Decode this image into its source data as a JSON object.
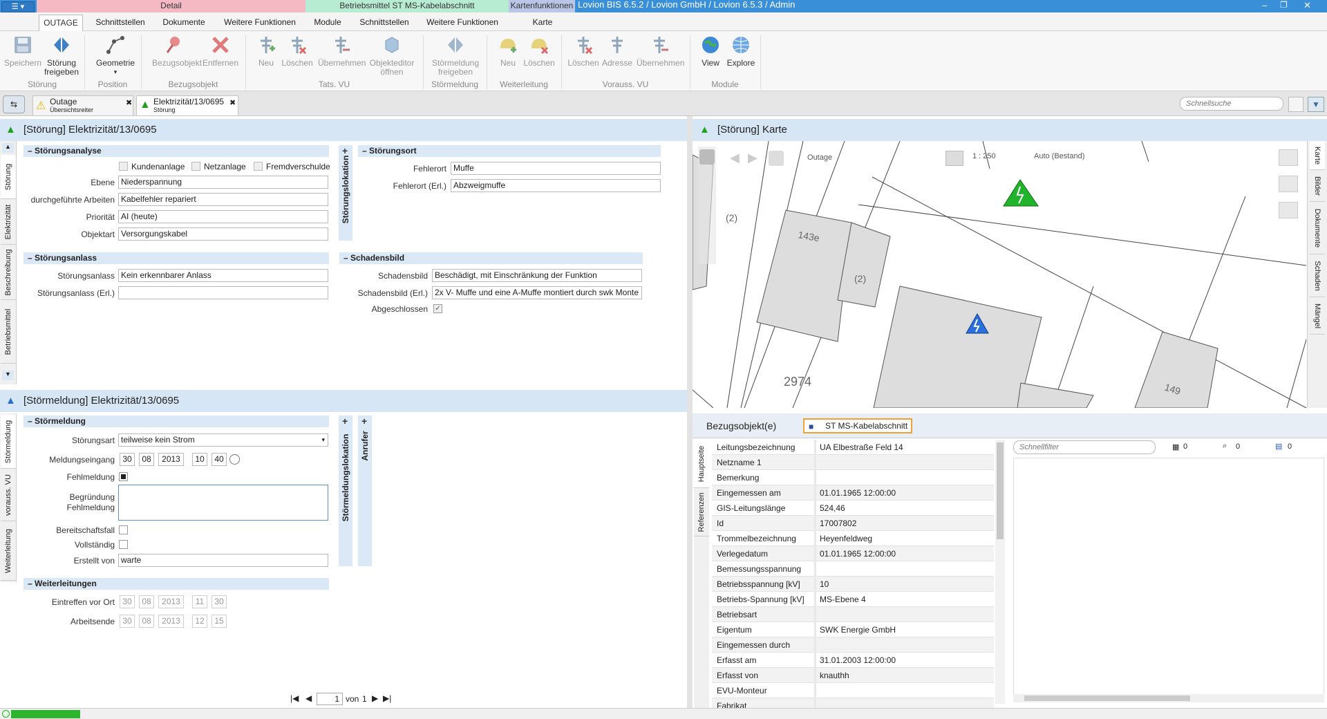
{
  "app": {
    "title": "Lovion BIS 6.5.2 / Lovion GmbH / Lovion 6.5.3 / Admin",
    "menu_button_icon": "app-menu-icon"
  },
  "context_tabs": {
    "detail": "Detail",
    "betriebsmittel": "Betriebsmittel ST MS-Kabelabschnitt",
    "kartenfunktionen": "Kartenfunktionen"
  },
  "ribbon_tabs": [
    "OUTAGE",
    "Schnittstellen",
    "Dokumente",
    "Weitere Funktionen",
    "Module",
    "Schnittstellen",
    "Weitere Funktionen",
    "Karte"
  ],
  "ribbon": {
    "groups": [
      "Störung",
      "Position",
      "Bezugsobjekt",
      "Tats. VU",
      "Störmeldung",
      "Weiterleitung",
      "Vorauss. VU",
      "Module"
    ],
    "buttons": {
      "speichern": "Speichern",
      "stoerung_freigeben": "Störung freigeben",
      "geometrie": "Geometrie",
      "bezugsobjekt": "Bezugsobjekt",
      "entfernen": "Entfernen",
      "neu": "Neu",
      "loeschen": "Löschen",
      "uebernehmen": "Übernehmen",
      "objekteditor": "Objekteditor öffnen",
      "stoermeldung_freigeben": "Störmeldung freigeben",
      "wl_neu": "Neu",
      "wl_loeschen": "Löschen",
      "vu_loeschen": "Löschen",
      "vu_adresse": "Adresse",
      "vu_uebernehmen": "Übernehmen",
      "view": "View",
      "explore": "Explore"
    }
  },
  "doc_tabs": [
    {
      "title": "Outage",
      "subtitle": "Übersichtsreiter"
    },
    {
      "title": "Elektrizität/13/0695",
      "subtitle": "Störung"
    }
  ],
  "search": {
    "placeholder": "Schnellsuche"
  },
  "stoerung_panel": {
    "title": "[Störung] Elektrizität/13/0695",
    "side_tabs": [
      "Störung",
      "Elektrizität",
      "Beschreibung",
      "Betriebsmittel"
    ],
    "analyse": {
      "header": "Störungsanalyse",
      "cb_kunden": "Kundenanlage",
      "cb_netz": "Netzanlage",
      "cb_fremd": "Fremdverschulde",
      "ebene_label": "Ebene",
      "ebene": "Niederspannung",
      "arbeiten_label": "durchgeführte Arbeiten",
      "arbeiten": "Kabelfehler repariert",
      "prio_label": "Priorität",
      "prio": "AI (heute)",
      "objektart_label": "Objektart",
      "objektart": "Versorgungskabel"
    },
    "lokation_tab": "Störungslokation",
    "ort": {
      "header": "Störungsort",
      "fehlerort_label": "Fehlerort",
      "fehlerort": "Muffe",
      "fehlerort_erl_label": "Fehlerort (Erl.)",
      "fehlerort_erl": "Abzweigmuffe"
    },
    "anlass": {
      "header": "Störungsanlass",
      "anlass_label": "Störungsanlass",
      "anlass": "Kein erkennbarer Anlass",
      "anlass_erl_label": "Störungsanlass (Erl.)",
      "anlass_erl": ""
    },
    "schaden": {
      "header": "Schadensbild",
      "bild_label": "Schadensbild",
      "bild": "Beschädigt, mit Einschränkung der Funktion",
      "bild_erl_label": "Schadensbild (Erl.)",
      "bild_erl": "2x V- Muffe und eine A-Muffe montiert durch swk Monte",
      "abgeschlossen_label": "Abgeschlossen",
      "abgeschlossen": true
    }
  },
  "meldung_panel": {
    "title": "[Störmeldung] Elektrizität/13/0695",
    "side_tabs": [
      "Störmeldung",
      "vorauss. VU",
      "Weiterleitung"
    ],
    "header": "Störmeldung",
    "art_label": "Störungsart",
    "art": "teilweise kein Strom",
    "eingang_label": "Meldungseingang",
    "eingang": {
      "d": "30",
      "m": "08",
      "y": "2013",
      "h": "10",
      "min": "40"
    },
    "fehl_label": "Fehlmeldung",
    "fehl": true,
    "begr_label": "Begründung Fehlmeldung",
    "begr": "",
    "bereit_label": "Bereitschaftsfall",
    "voll_label": "Vollständig",
    "erstellt_label": "Erstellt von",
    "erstellt": "warte",
    "lokation_tab": "Störmeldungslokation",
    "anrufer_tab": "Anrufer",
    "weiter_header": "Weiterleitungen",
    "eintreffen_label": "Eintreffen vor Ort",
    "eintreffen": {
      "d": "30",
      "m": "08",
      "y": "2013",
      "h": "11",
      "min": "30"
    },
    "ende_label": "Arbeitsende",
    "ende": {
      "d": "30",
      "m": "08",
      "y": "2013",
      "h": "12",
      "min": "15"
    },
    "pager": {
      "page": "1",
      "von": "von",
      "total": "1"
    }
  },
  "map_panel": {
    "title": "[Störung] Karte",
    "layer": "Outage",
    "scale": "1 : 250",
    "mode": "Auto (Bestand)",
    "labels": {
      "a": "(2)",
      "b": "143e",
      "c": "(2)",
      "d": "2974",
      "e": "149"
    },
    "side_tabs": [
      "Karte",
      "Bilder",
      "Dokumente",
      "Schaden",
      "Mängel"
    ]
  },
  "bezug": {
    "label": "Bezugsobjekt(e)",
    "object": "ST MS-Kabelabschnitt",
    "side_tabs": [
      "Hauptseite",
      "Referenzen"
    ],
    "filter_placeholder": "Schnellfilter",
    "count1": "0",
    "count2": "0",
    "count3": "0",
    "rows": [
      {
        "k": "Leitungsbezeichnung",
        "v": "UA Elbestraße Feld 14"
      },
      {
        "k": "Netzname 1",
        "v": ""
      },
      {
        "k": "Bemerkung",
        "v": ""
      },
      {
        "k": "Eingemessen am",
        "v": "01.01.1965 12:00:00"
      },
      {
        "k": "GIS-Leitungslänge",
        "v": "524,46"
      },
      {
        "k": "Id",
        "v": "17007802"
      },
      {
        "k": "Trommelbezeichnung",
        "v": "Heyenfeldweg"
      },
      {
        "k": "Verlegedatum",
        "v": "01.01.1965 12:00:00"
      },
      {
        "k": "Bemessungsspannung",
        "v": ""
      },
      {
        "k": "Betriebsspannung [kV]",
        "v": "10"
      },
      {
        "k": "Betriebs-Spannung [kV]",
        "v": "MS-Ebene 4"
      },
      {
        "k": "Betriebsart",
        "v": ""
      },
      {
        "k": "Eigentum",
        "v": "SWK Energie GmbH"
      },
      {
        "k": "Eingemessen durch",
        "v": ""
      },
      {
        "k": "Erfasst am",
        "v": "31.01.2003 12:00:00"
      },
      {
        "k": "Erfasst von",
        "v": "knauthh"
      },
      {
        "k": "EVU-Monteur",
        "v": ""
      },
      {
        "k": "Fabrikat",
        "v": ""
      }
    ]
  },
  "colors": {
    "accent": "#3a8fd9",
    "panel_title": "#d6e6f5",
    "section": "#dbe8f5",
    "status_ok": "#2db52d"
  }
}
